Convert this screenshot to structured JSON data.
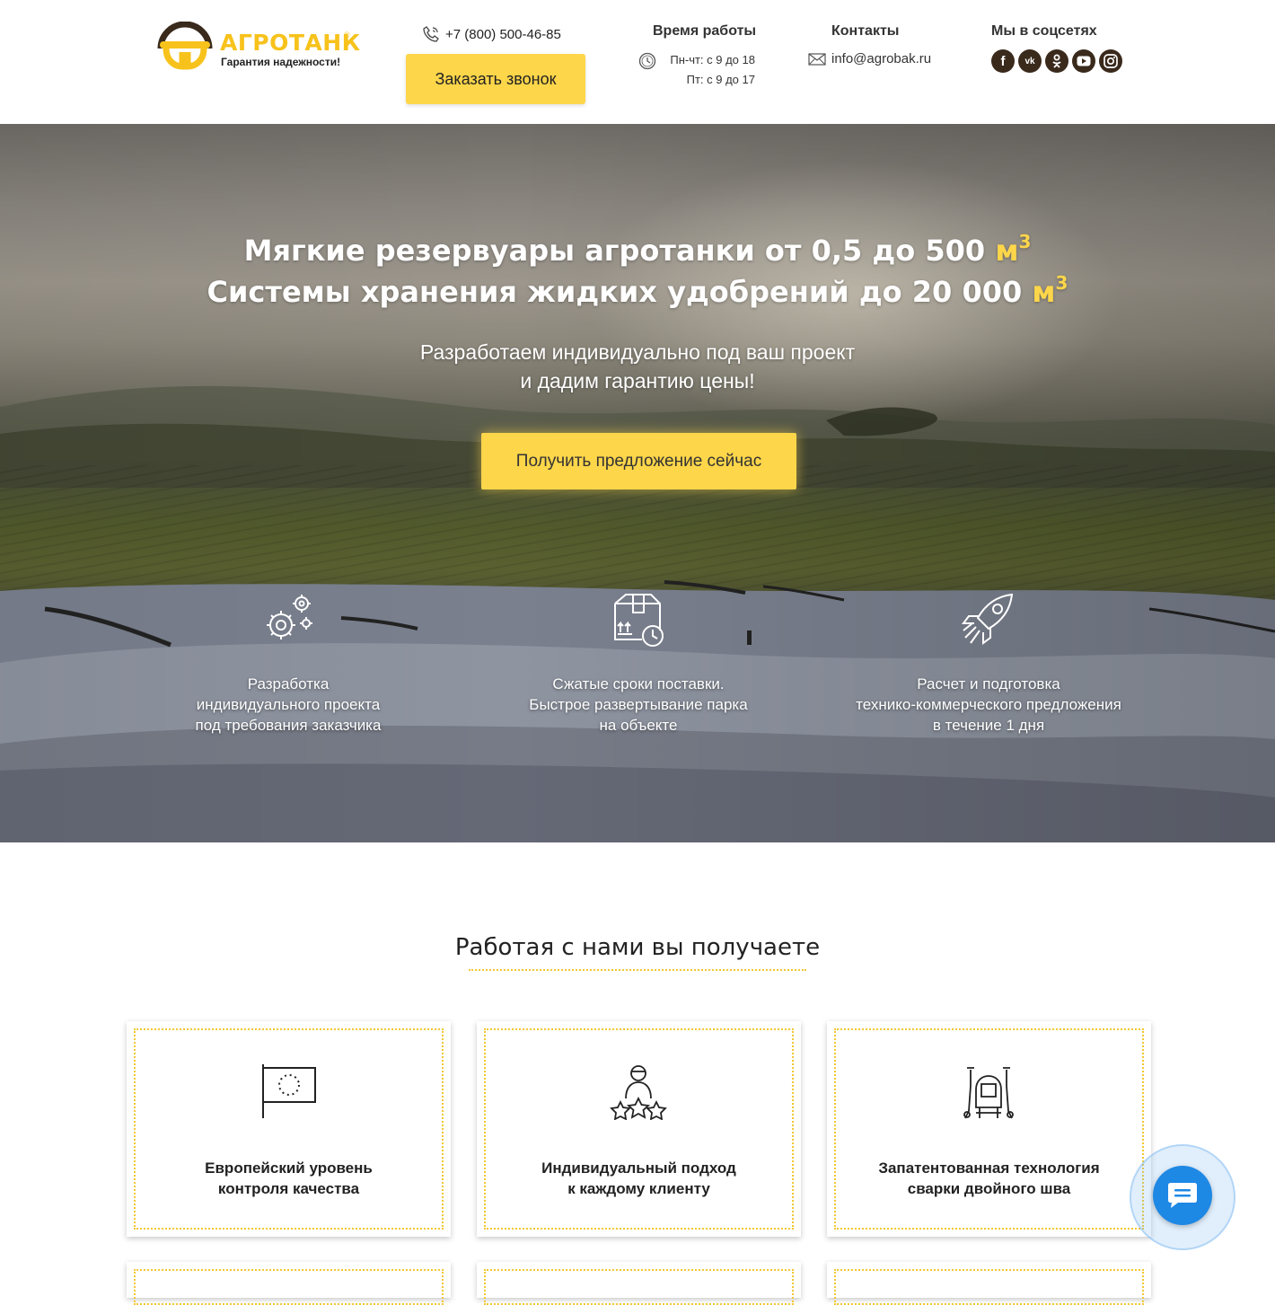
{
  "header": {
    "logo": {
      "name": "АГРОТАНК",
      "reg": "®",
      "tagline": "Гарантия надежности!"
    },
    "phone": "+7 (800) 500-46-85",
    "call_button": "Заказать звонок",
    "hours": {
      "title": "Время работы",
      "line1": "Пн-чт: с 9 до 18",
      "line2": "Пт: с 9 до 17"
    },
    "contacts": {
      "title": "Контакты",
      "email": "info@agrobak.ru"
    },
    "social": {
      "title": "Мы в соцсетях",
      "items": [
        "facebook-icon",
        "vk-icon",
        "odnoklassniki-icon",
        "youtube-icon",
        "instagram-icon"
      ]
    }
  },
  "hero": {
    "line1": "Мягкие резервуары агротанки от 0,5 до 500",
    "line2": "Системы хранения жидких удобрений до 20 000",
    "unit": "м",
    "unit_power": "3",
    "sub_line1": "Разработаем индивидуально под ваш проект",
    "sub_line2": "и дадим гарантию цены!",
    "cta": "Получить предложение сейчас",
    "features": [
      {
        "icon": "gears-icon",
        "text": "Разработка\nиндивидуального проекта\nпод требования заказчика"
      },
      {
        "icon": "box-clock-icon",
        "text": "Сжатые сроки поставки.\nБыстрое развертывание парка\nна объекте"
      },
      {
        "icon": "rocket-icon",
        "text": "Расчет и подготовка\nтехнико-коммерческого предложения\nв течение 1 дня"
      }
    ]
  },
  "benefits": {
    "title": "Работая с нами вы получаете",
    "cards": [
      {
        "icon": "eu-flag-icon",
        "text": "Европейский уровень\nконтроля качества"
      },
      {
        "icon": "person-stars-icon",
        "text": "Индивидуальный подход\nк каждому клиенту"
      },
      {
        "icon": "welder-icon",
        "text": "Запатентованная технология\nсварки двойного шва"
      }
    ]
  },
  "colors": {
    "accent": "#fdd64a",
    "logo": "#f7c21b",
    "chat": "#1e88e5",
    "social": "#3a2a1c"
  }
}
